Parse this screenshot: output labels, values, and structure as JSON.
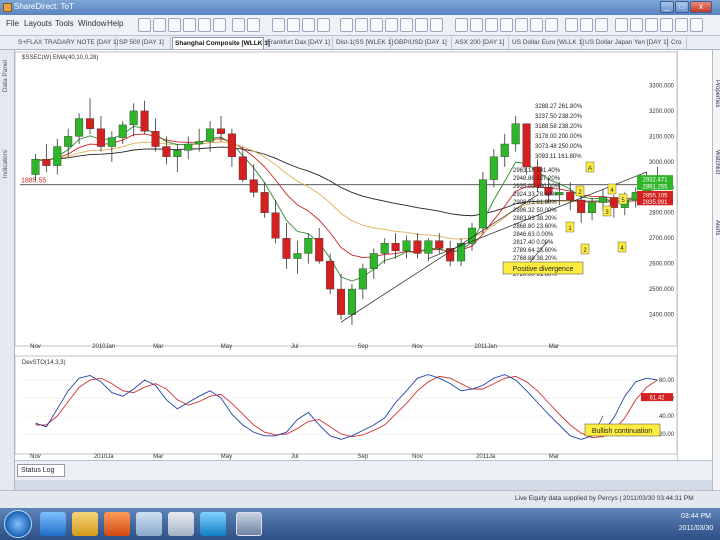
{
  "window": {
    "title": "ShareDirect: ToT"
  },
  "menu": [
    "File",
    "Layouts",
    "Tools",
    "Window",
    "Help"
  ],
  "tabs": [
    "S+FLAX TRADARY NOTE [DAY 1]",
    "SP 500 [DAY 1]",
    "Shanghai Composite [WLLK 1]",
    "Frankfurt Dax [DAY 1]",
    "Dist-1(SS [WLEK 1]",
    "GBP/USD [DAY 1]",
    "ASX 200 [DAY 1]",
    "US Dollar Euro [WLLK 1]",
    "US Dollar Japan Yen [DAY 1]",
    "Cro"
  ],
  "sidebar": {
    "top_label": "Data Panel",
    "mid_label": "Indicators"
  },
  "right_tools": [
    "Properties",
    "Watchlist",
    "Alerts"
  ],
  "chart": {
    "price_header": "$SSEC(W)  EMA(40,10,0,28)",
    "osc_header": "DevSTO(14,3,3)",
    "price_axis": [
      "3300.000",
      "3200.000",
      "3100.000",
      "3000.000",
      "2900.000",
      "2800.000",
      "2700.000",
      "2600.000",
      "2500.000",
      "2400.000"
    ],
    "osc_axis": [
      "80.00",
      "60.00",
      "40.00",
      "20.00"
    ],
    "x_labels_price": [
      "Nov",
      "2010Jan",
      "Mar",
      "May",
      "Jul",
      "Sep",
      "Nov",
      "2011Jan",
      "Mar"
    ],
    "x_labels_osc": [
      "Nov",
      "2010Ja",
      "Mar",
      "May",
      "Jul",
      "Sep",
      "Nov",
      "2011Ja",
      "Mar"
    ],
    "left_level": "1885.55",
    "price_tags": [
      "2932.471",
      "2891.255",
      "2855.105",
      "2835.991"
    ],
    "osc_tag": "61.42",
    "fib_upper": [
      "3288.27  261.80%",
      "3237.50  238.20%",
      "3188.58  238.20%",
      "3178.00  200.00%",
      "3073.48  250.00%",
      "3093.11  161.80%"
    ],
    "fib_lower": [
      "2963.16  141.40%",
      "2948.86  127.20%",
      "2935.00  100.00%",
      "2924.33  78.60%",
      "2908.73  61.80%",
      "2896.32  50.00%",
      "2883.93  38.20%",
      "2868.80  23.60%",
      "2846.63  0.00%",
      "2817.40  0.00%",
      "2789.64  23.60%",
      "2768.88  38.20%",
      "2745.14  50.00%",
      "2720.00  61.80%"
    ],
    "fib_markers": [
      "1",
      "2",
      "A",
      "3",
      "4",
      "5",
      "2",
      "4"
    ],
    "annotations": {
      "divergence": "Positive divergence",
      "continuation": "Bullish continuation"
    }
  },
  "bottom": {
    "button": "Status Log"
  },
  "status": {
    "text": "Live Equity data supplied by Percys  |  2011/03/30 03:44:31 PM"
  },
  "taskbar": {
    "time": "03:44 PM",
    "date": "2011/03/30"
  },
  "colors": {
    "up": "#2fb52a",
    "down": "#d42020",
    "bg": "#ffffff",
    "ema_fast": "#cc2222",
    "ema_slow": "#222222",
    "ema_mid": "#2e8b2e",
    "stoch_k": "#2244aa",
    "stoch_d": "#d23232",
    "highlight": "#ffec40"
  },
  "chart_data": {
    "type": "candlestick",
    "ylim": [
      2300,
      3400
    ],
    "candles": [
      [
        2950,
        3030,
        2925,
        3010
      ],
      [
        3010,
        3070,
        2960,
        2985
      ],
      [
        2985,
        3090,
        2950,
        3060
      ],
      [
        3060,
        3130,
        3020,
        3100
      ],
      [
        3100,
        3190,
        3070,
        3170
      ],
      [
        3170,
        3250,
        3110,
        3130
      ],
      [
        3130,
        3180,
        3040,
        3060
      ],
      [
        3060,
        3120,
        3000,
        3095
      ],
      [
        3095,
        3160,
        3070,
        3145
      ],
      [
        3145,
        3230,
        3100,
        3200
      ],
      [
        3200,
        3240,
        3110,
        3120
      ],
      [
        3120,
        3170,
        3040,
        3060
      ],
      [
        3060,
        3100,
        2990,
        3020
      ],
      [
        3020,
        3070,
        2960,
        3045
      ],
      [
        3045,
        3100,
        3010,
        3070
      ],
      [
        3070,
        3130,
        3040,
        3080
      ],
      [
        3080,
        3160,
        3040,
        3130
      ],
      [
        3130,
        3180,
        3080,
        3110
      ],
      [
        3110,
        3130,
        2980,
        3020
      ],
      [
        3020,
        3060,
        2920,
        2930
      ],
      [
        2930,
        2990,
        2860,
        2880
      ],
      [
        2880,
        2920,
        2780,
        2800
      ],
      [
        2800,
        2850,
        2680,
        2700
      ],
      [
        2700,
        2760,
        2580,
        2620
      ],
      [
        2620,
        2690,
        2560,
        2640
      ],
      [
        2640,
        2720,
        2600,
        2700
      ],
      [
        2700,
        2740,
        2600,
        2610
      ],
      [
        2610,
        2640,
        2480,
        2500
      ],
      [
        2500,
        2560,
        2380,
        2400
      ],
      [
        2400,
        2520,
        2360,
        2500
      ],
      [
        2500,
        2600,
        2460,
        2580
      ],
      [
        2580,
        2660,
        2540,
        2640
      ],
      [
        2640,
        2700,
        2600,
        2680
      ],
      [
        2680,
        2720,
        2620,
        2650
      ],
      [
        2650,
        2710,
        2620,
        2690
      ],
      [
        2690,
        2720,
        2620,
        2640
      ],
      [
        2640,
        2700,
        2610,
        2690
      ],
      [
        2690,
        2720,
        2640,
        2660
      ],
      [
        2660,
        2690,
        2590,
        2610
      ],
      [
        2610,
        2700,
        2590,
        2680
      ],
      [
        2680,
        2760,
        2650,
        2740
      ],
      [
        2740,
        2960,
        2720,
        2930
      ],
      [
        2930,
        3050,
        2900,
        3020
      ],
      [
        3020,
        3110,
        2980,
        3070
      ],
      [
        3070,
        3180,
        3040,
        3150
      ],
      [
        3150,
        3150,
        2950,
        2980
      ],
      [
        2980,
        3010,
        2880,
        2900
      ],
      [
        2900,
        2940,
        2840,
        2870
      ],
      [
        2870,
        2920,
        2830,
        2880
      ],
      [
        2880,
        2920,
        2810,
        2850
      ],
      [
        2850,
        2900,
        2760,
        2800
      ],
      [
        2800,
        2860,
        2770,
        2840
      ],
      [
        2840,
        2890,
        2810,
        2860
      ],
      [
        2860,
        2870,
        2780,
        2820
      ],
      [
        2820,
        2880,
        2790,
        2850
      ],
      [
        2850,
        2900,
        2820,
        2880
      ],
      [
        2880,
        2960,
        2860,
        2940
      ],
      [
        2940,
        2980,
        2900,
        2910
      ]
    ],
    "stoch_k": [
      32,
      28,
      48,
      68,
      82,
      85,
      78,
      66,
      62,
      70,
      80,
      74,
      58,
      48,
      55,
      62,
      68,
      60,
      42,
      30,
      22,
      18,
      18,
      22,
      36,
      44,
      30,
      18,
      14,
      18,
      24,
      30,
      38,
      55,
      68,
      82,
      86,
      82,
      76,
      68,
      70,
      74,
      82,
      86,
      80,
      68,
      55,
      42,
      30,
      18,
      14,
      18,
      22,
      38,
      62,
      78,
      82,
      80
    ],
    "stoch_d": [
      30,
      30,
      40,
      56,
      72,
      80,
      82,
      76,
      68,
      66,
      72,
      76,
      70,
      58,
      52,
      56,
      62,
      64,
      54,
      42,
      30,
      22,
      19,
      20,
      26,
      34,
      36,
      28,
      20,
      17,
      19,
      24,
      30,
      42,
      54,
      68,
      78,
      84,
      82,
      76,
      70,
      70,
      76,
      82,
      84,
      78,
      68,
      55,
      42,
      30,
      21,
      16,
      17,
      24,
      38,
      58,
      72,
      80
    ]
  }
}
